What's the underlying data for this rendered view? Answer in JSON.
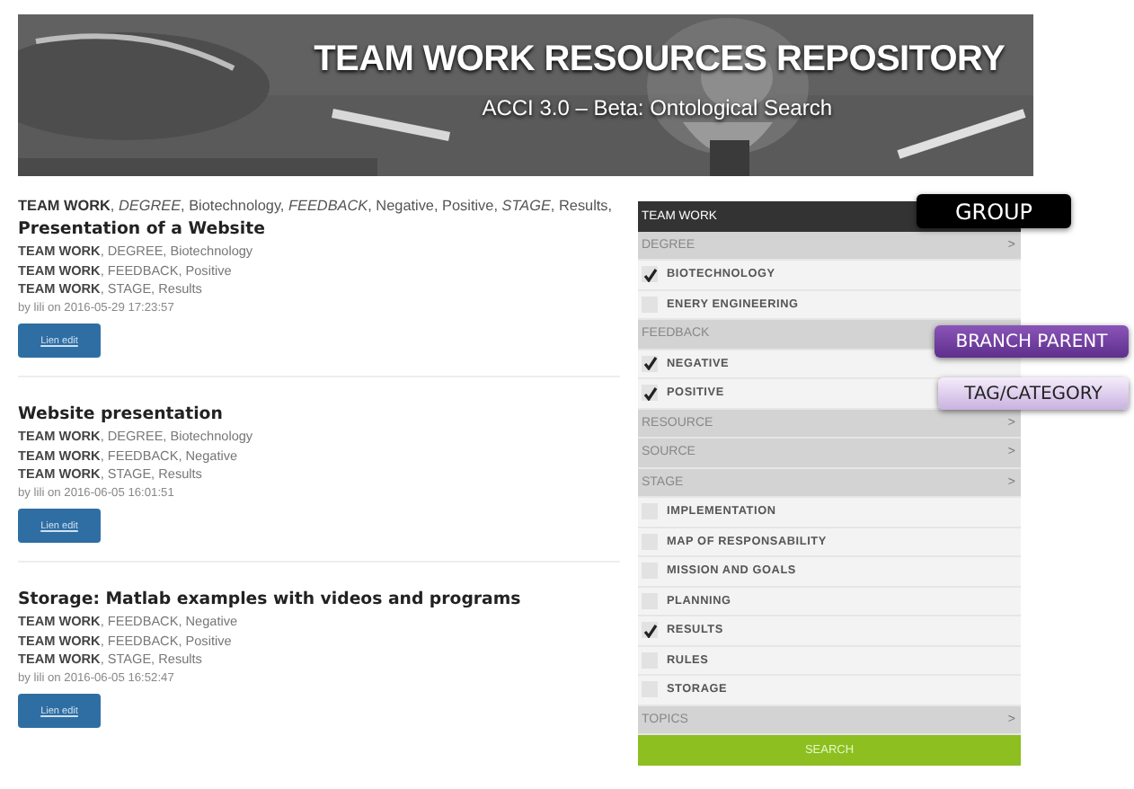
{
  "banner": {
    "title": "TEAM WORK RESOURCES REPOSITORY",
    "subtitle": "ACCI 3.0 – Beta: Ontological Search"
  },
  "filter_summary": "**TEAM WORK**, *DEGREE*, Biotechnology, *FEEDBACK*, Negative, Positive, *STAGE*, Results,",
  "results": [
    {
      "title": "Presentation of a Website",
      "tags": [
        "**TEAM WORK**, DEGREE, Biotechnology",
        "**TEAM WORK**, FEEDBACK, Positive",
        "**TEAM WORK**, STAGE, Results"
      ],
      "byline": "by lili on 2016-05-29 17:23:57",
      "button": "Lien edit"
    },
    {
      "title": "Website presentation",
      "tags": [
        "**TEAM WORK**, DEGREE, Biotechnology",
        "**TEAM WORK**, FEEDBACK, Negative",
        "**TEAM WORK**, STAGE, Results"
      ],
      "byline": "by lili on 2016-06-05 16:01:51",
      "button": "Lien edit"
    },
    {
      "title": "Storage: Matlab examples with videos and programs",
      "tags": [
        "**TEAM WORK**, FEEDBACK, Negative",
        "**TEAM WORK**, FEEDBACK, Positive",
        "**TEAM WORK**, STAGE, Results"
      ],
      "byline": "by lili on 2016-06-05 16:52:47",
      "button": "Lien edit"
    }
  ],
  "filter_panel": {
    "header": "TEAM WORK",
    "rows": [
      {
        "kind": "category",
        "label": "DEGREE",
        "arrow": ">"
      },
      {
        "kind": "option",
        "label": "BIOTECHNOLOGY",
        "checked": true
      },
      {
        "kind": "option",
        "label": "ENERY ENGINEERING",
        "checked": false
      },
      {
        "kind": "category",
        "label": "FEEDBACK"
      },
      {
        "kind": "option",
        "label": "NEGATIVE",
        "checked": true
      },
      {
        "kind": "option",
        "label": "POSITIVE",
        "checked": true
      },
      {
        "kind": "category",
        "label": "RESOURCE",
        "arrow": ">"
      },
      {
        "kind": "category",
        "label": "SOURCE",
        "arrow": ">"
      },
      {
        "kind": "category",
        "label": "STAGE",
        "arrow": ">"
      },
      {
        "kind": "option",
        "label": "IMPLEMENTATION",
        "checked": false
      },
      {
        "kind": "option",
        "label": "MAP OF RESPONSABILITY",
        "checked": false
      },
      {
        "kind": "option",
        "label": "MISSION AND GOALS",
        "checked": false
      },
      {
        "kind": "option",
        "label": "PLANNING",
        "checked": false
      },
      {
        "kind": "option",
        "label": "RESULTS",
        "checked": true
      },
      {
        "kind": "option",
        "label": "RULES",
        "checked": false
      },
      {
        "kind": "option",
        "label": "STORAGE",
        "checked": false
      },
      {
        "kind": "category",
        "label": "TOPICS",
        "arrow": ">"
      }
    ],
    "search_button": "SEARCH"
  },
  "callouts": [
    {
      "kind": "group",
      "label": "GROUP"
    },
    {
      "kind": "branch",
      "label": "BRANCH PARENT"
    },
    {
      "kind": "tag",
      "label": "TAG/CATEGORY"
    }
  ]
}
